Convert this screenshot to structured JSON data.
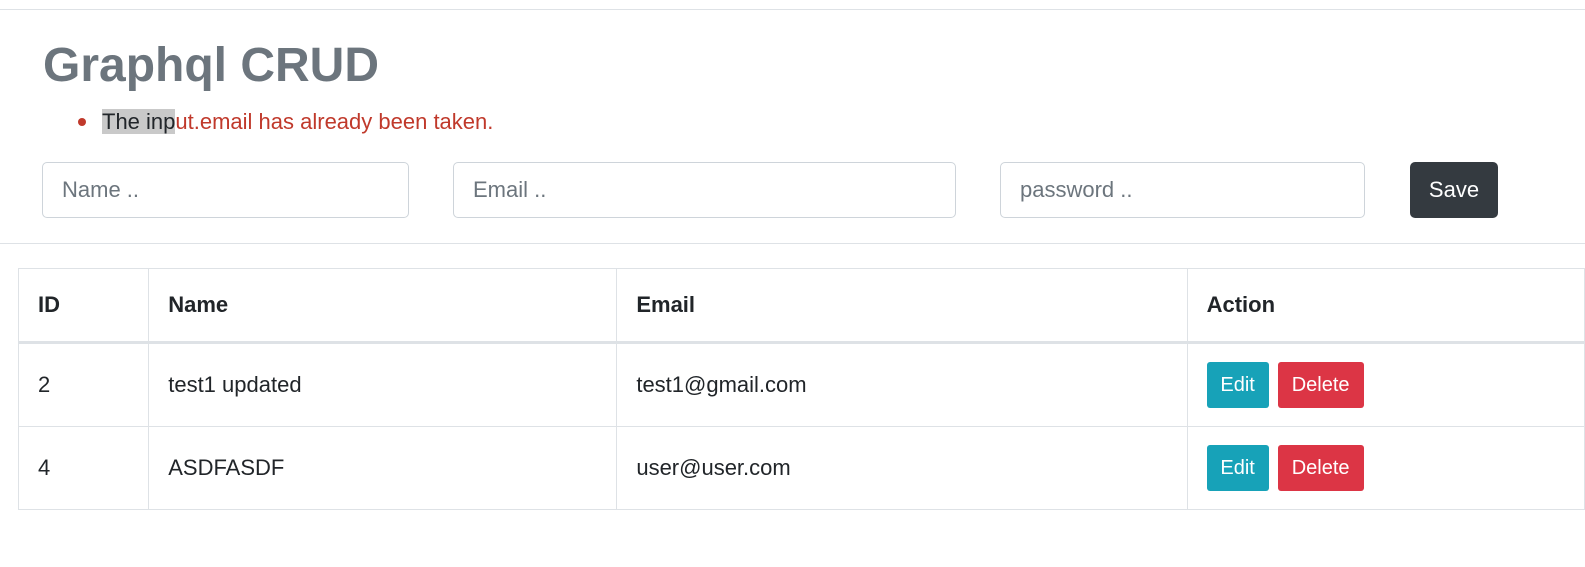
{
  "header": {
    "title": "Graphql CRUD"
  },
  "errors": [
    {
      "selected_text": "The inp",
      "rest_text": "ut.email has already been taken."
    }
  ],
  "form": {
    "name_placeholder": "Name ..",
    "email_placeholder": "Email ..",
    "password_placeholder": "password ..",
    "save_label": "Save"
  },
  "table": {
    "headers": [
      "ID",
      "Name",
      "Email",
      "Action"
    ],
    "rows": [
      {
        "id": "2",
        "name": "test1 updated",
        "email": "test1@gmail.com",
        "edit_label": "Edit",
        "delete_label": "Delete"
      },
      {
        "id": "4",
        "name": "ASDFASDF",
        "email": "user@user.com",
        "edit_label": "Edit",
        "delete_label": "Delete"
      }
    ]
  },
  "colors": {
    "title": "#6c757d",
    "error": "#c0392b",
    "save_button": "#343a40",
    "edit_button": "#17a2b8",
    "delete_button": "#dc3545"
  }
}
